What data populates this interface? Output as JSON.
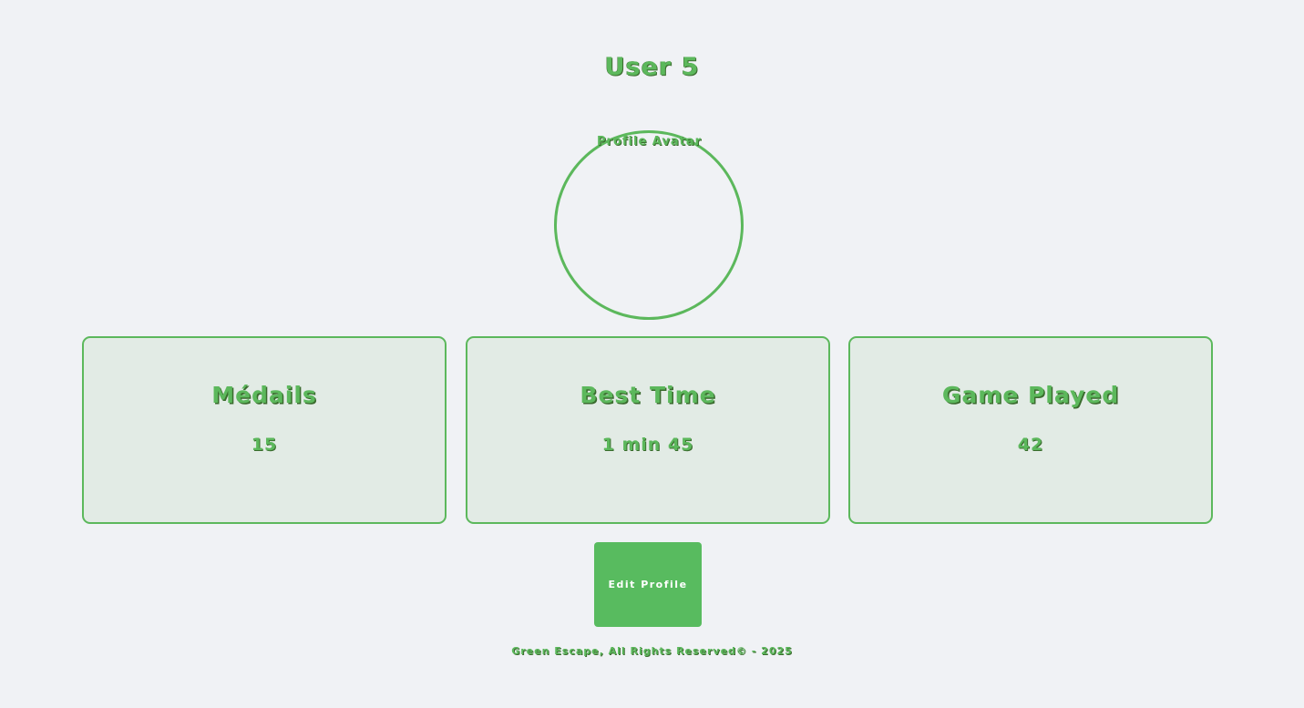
{
  "profile": {
    "username": "User 5",
    "avatar_alt": "Profile Avatar"
  },
  "stats": [
    {
      "label": "Médails",
      "value": "15"
    },
    {
      "label": "Best Time",
      "value": "1 min 45"
    },
    {
      "label": "Game Played",
      "value": "42"
    }
  ],
  "actions": {
    "edit_label": "Edit Profile"
  },
  "footer": {
    "text": "Green Escape, All Rights Reserved© - 2025"
  },
  "colors": {
    "accent": "#5cb85c",
    "background": "#f0f2f5",
    "card_background": "#e2ebe5",
    "text_shadow": "#3a6b2e",
    "button_text": "#ffffff"
  }
}
